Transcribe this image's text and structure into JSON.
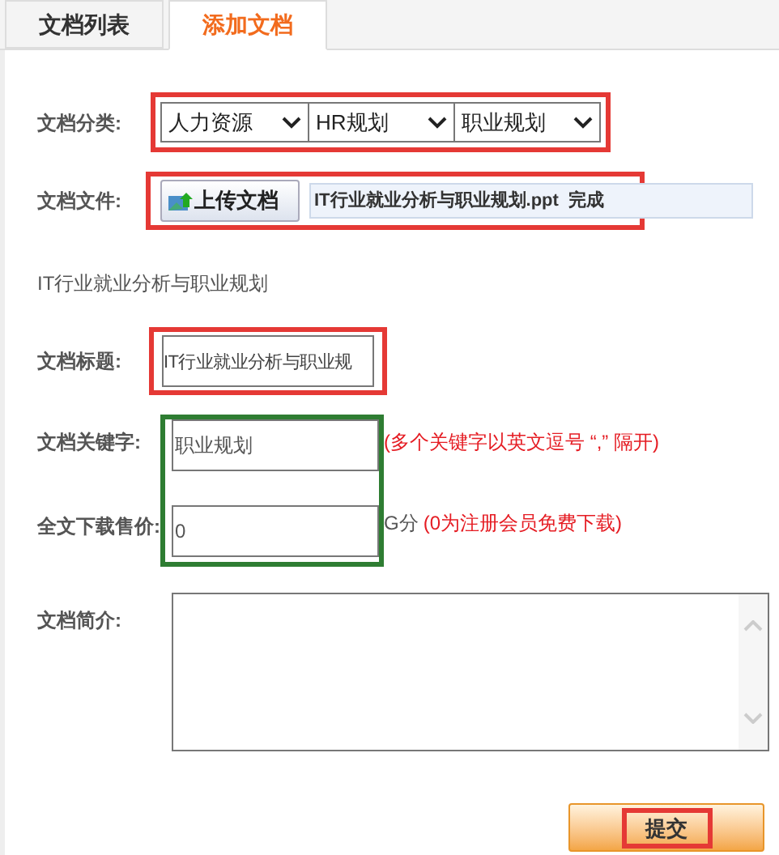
{
  "tabs": [
    {
      "label": "文档列表",
      "selected": false
    },
    {
      "label": "添加文档",
      "selected": true
    }
  ],
  "category": {
    "label": "文档分类:",
    "color": "#e53935",
    "selects": [
      "人力资源",
      "HR规划",
      "职业规划"
    ]
  },
  "file": {
    "label": "文档文件:",
    "color": "#e53935",
    "button": "上传文档",
    "filename": "IT行业就业分析与职业规划.ppt",
    "status": "完成"
  },
  "file_caption": "IT行业就业分析与职业规划",
  "title": {
    "label": "文档标题:",
    "color": "#e53935",
    "value": "IT行业就业分析与职业规"
  },
  "pricing_group": {
    "color": "#2e7d32",
    "keywords": {
      "label": "文档关键字:",
      "value": "职业规划",
      "note": "(多个关键字以英文逗号 “,”  隔开)"
    },
    "price": {
      "label": "全文下载售价:",
      "value": "0",
      "unit": "G分",
      "note": "(0为注册会员免费下载)"
    }
  },
  "intro": {
    "label": "文档简介:"
  },
  "submit": {
    "label": "提交",
    "color": "#e53935"
  }
}
